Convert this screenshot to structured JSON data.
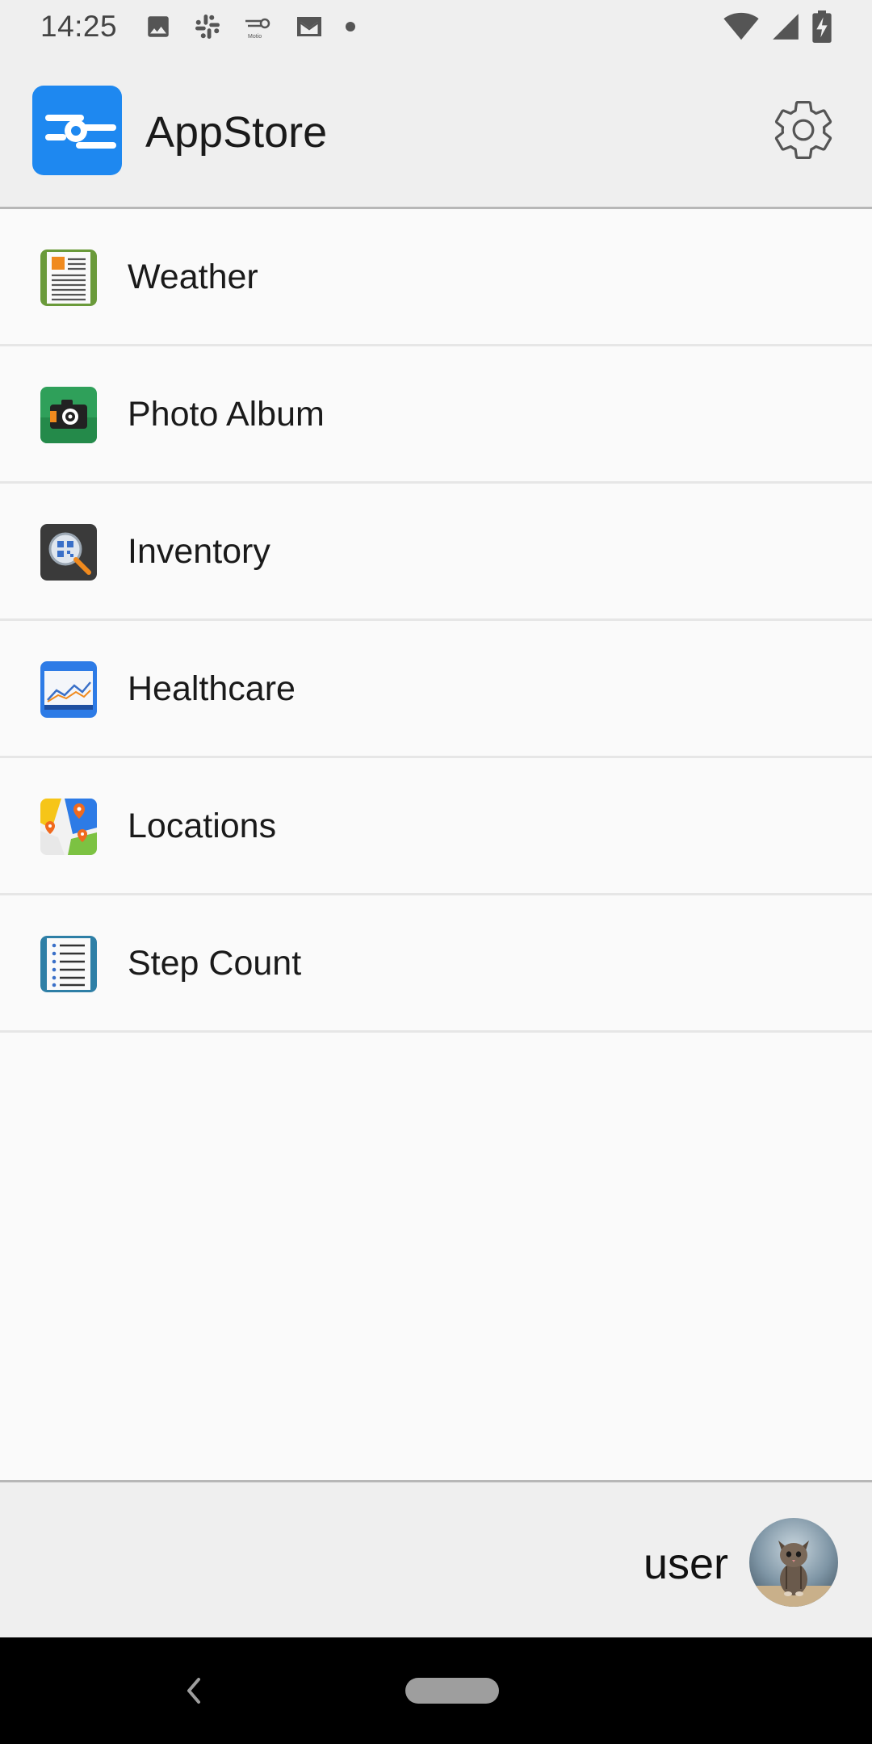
{
  "status_bar": {
    "time": "14:25",
    "notification_icons": [
      "image-icon",
      "slack-icon",
      "motio-icon",
      "gmail-icon",
      "dot-icon"
    ],
    "system_icons": [
      "wifi-icon",
      "cell-signal-icon",
      "battery-charging-icon"
    ]
  },
  "app_bar": {
    "title": "AppStore",
    "logo_icon": "appstore-logo-icon",
    "settings_icon": "gear-icon"
  },
  "apps": [
    {
      "label": "Weather",
      "icon": "weather-app-icon"
    },
    {
      "label": "Photo Album",
      "icon": "photo-album-app-icon"
    },
    {
      "label": "Inventory",
      "icon": "inventory-app-icon"
    },
    {
      "label": "Healthcare",
      "icon": "healthcare-app-icon"
    },
    {
      "label": "Locations",
      "icon": "locations-app-icon"
    },
    {
      "label": "Step Count",
      "icon": "step-count-app-icon"
    }
  ],
  "footer": {
    "username": "user",
    "avatar_icon": "kitten-avatar"
  },
  "navigation": {
    "back_icon": "back-chevron-icon",
    "home_icon": "home-pill-icon"
  },
  "colors": {
    "accent": "#1e88f0",
    "bar_background": "#efefef",
    "list_background": "#fafafa",
    "nav_background": "#000000"
  }
}
